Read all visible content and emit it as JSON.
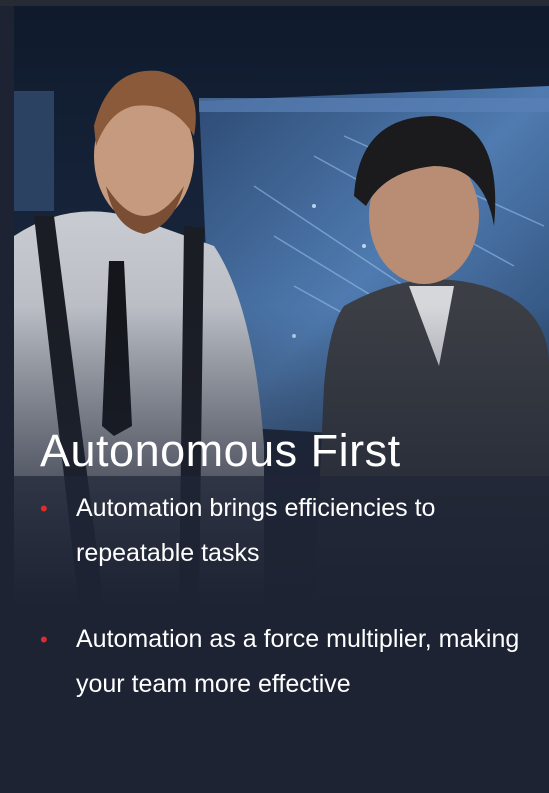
{
  "title": "Autonomous First",
  "bullets": [
    {
      "text": "Automation brings efficiencies to repeatable tasks"
    },
    {
      "text": "Automation as a force multiplier, making your team more effective"
    }
  ],
  "bullet_symbol": "•",
  "colors": {
    "background": "#1d2333",
    "bullet": "#e02b2b",
    "text": "#ffffff"
  }
}
